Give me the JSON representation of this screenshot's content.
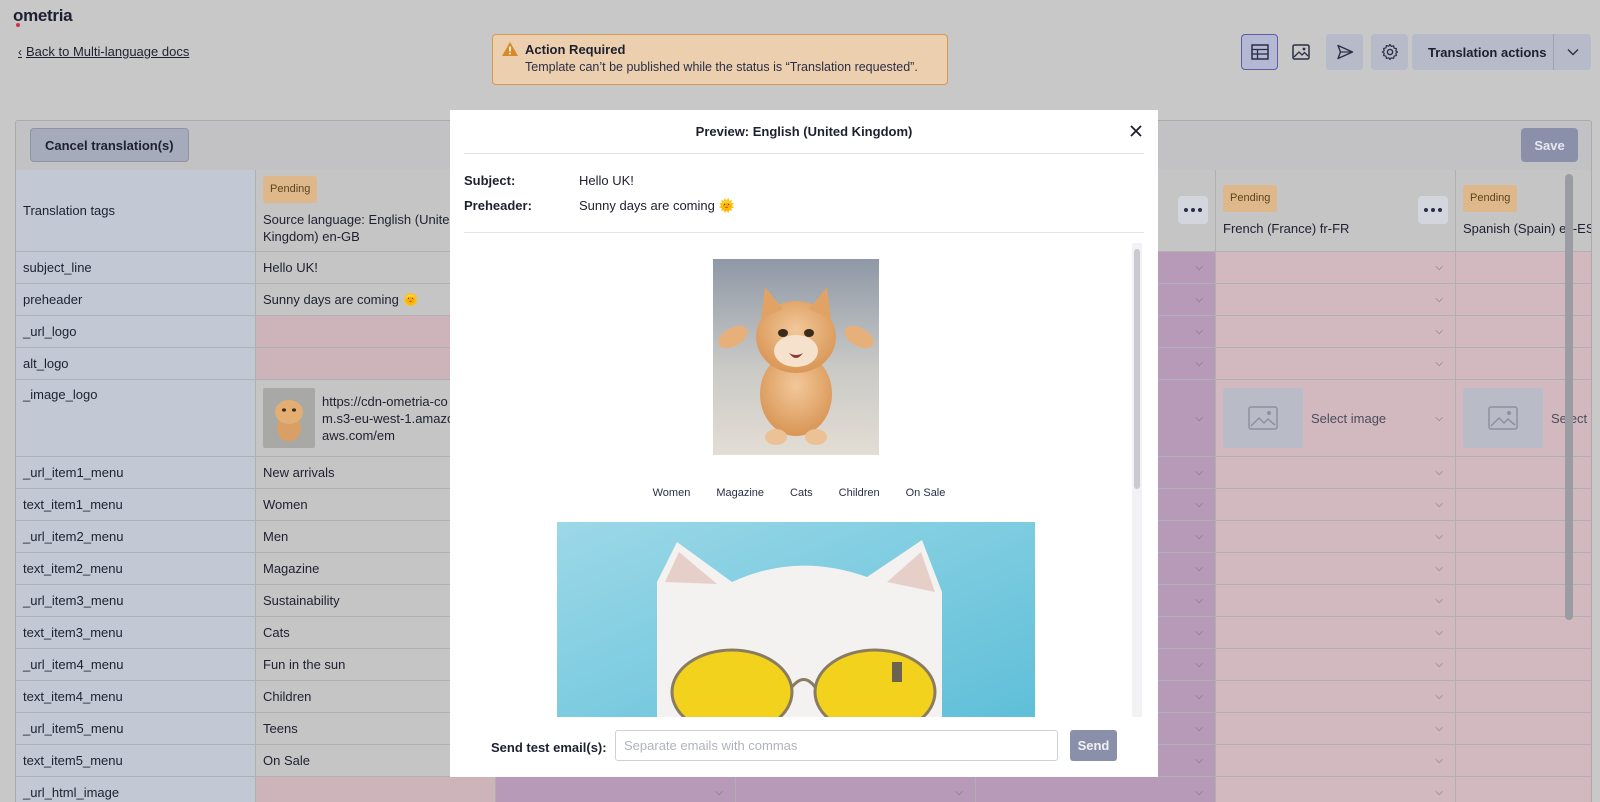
{
  "app": {
    "logo": "ometria"
  },
  "nav": {
    "back_label": "Back to Multi-language docs"
  },
  "alert": {
    "title": "Action Required",
    "message": "Template can’t be published while the status is “Translation requested”."
  },
  "toolbar": {
    "icons": [
      "table-view-icon",
      "image-view-icon",
      "send-icon",
      "settings-icon"
    ],
    "translation_actions_label": "Translation actions"
  },
  "panel": {
    "cancel_label": "Cancel translation(s)",
    "save_label": "Save",
    "tags_header": "Translation tags",
    "source": {
      "badge": "Pending",
      "header": "Source language: English (United Kingdom) en-GB"
    },
    "languages": [
      {
        "badge": "Pending",
        "header": "French (France) fr-FR"
      },
      {
        "badge": "Pending",
        "header": "Spanish (Spain) es-ES"
      }
    ],
    "select_image_label": "Select image",
    "rows": [
      {
        "tag": "subject_line",
        "value": "Hello UK!"
      },
      {
        "tag": "preheader",
        "value": "Sunny days are coming 🌞"
      },
      {
        "tag": "_url_logo",
        "value": ""
      },
      {
        "tag": "alt_logo",
        "value": ""
      },
      {
        "tag": "_image_logo",
        "value": "https://cdn-ometria-com.s3-eu-west-1.amazonaws.com/em"
      },
      {
        "tag": "_url_item1_menu",
        "value": "New arrivals"
      },
      {
        "tag": "text_item1_menu",
        "value": "Women"
      },
      {
        "tag": "_url_item2_menu",
        "value": "Men"
      },
      {
        "tag": "text_item2_menu",
        "value": "Magazine"
      },
      {
        "tag": "_url_item3_menu",
        "value": "Sustainability"
      },
      {
        "tag": "text_item3_menu",
        "value": "Cats"
      },
      {
        "tag": "_url_item4_menu",
        "value": "Fun in the sun"
      },
      {
        "tag": "text_item4_menu",
        "value": "Children"
      },
      {
        "tag": "_url_item5_menu",
        "value": "Teens"
      },
      {
        "tag": "text_item5_menu",
        "value": "On Sale"
      },
      {
        "tag": "_url_html_image",
        "value": ""
      }
    ]
  },
  "modal": {
    "title": "Preview: English (United Kingdom)",
    "subject_label": "Subject:",
    "subject_value": "Hello UK!",
    "preheader_label": "Preheader:",
    "preheader_value": "Sunny days are coming 🌞",
    "menu_items": [
      "Women",
      "Magazine",
      "Cats",
      "Children",
      "On Sale"
    ],
    "send_test_label": "Send test email(s):",
    "send_test_placeholder": "Separate emails with commas",
    "send_label": "Send"
  },
  "colors": {
    "accent": "#5c5ea8",
    "pending_badge": "#deb88a",
    "alert_bg": "#eccfae",
    "alert_border": "#d59a55"
  }
}
